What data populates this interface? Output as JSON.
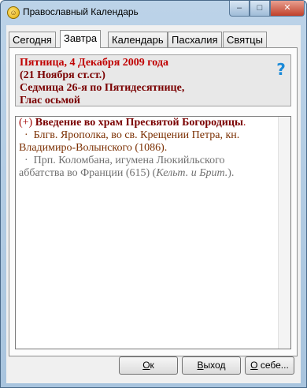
{
  "window": {
    "title": "Православный Календарь"
  },
  "titlebar": {
    "minimize": "–",
    "maximize": "□",
    "close": "✕"
  },
  "tabs": [
    {
      "label": "Сегодня"
    },
    {
      "label": "Завтра"
    },
    {
      "label": "Календарь"
    },
    {
      "label": "Пасхалия"
    },
    {
      "label": "Святцы"
    }
  ],
  "header": {
    "date": "Пятница, 4 Декабря 2009 года",
    "old_style": "(21 Ноября ст.ст.)",
    "week": "Седмица 26-я по Пятидесятнице,",
    "tone": "Глас осьмой",
    "help_icon": "help-icon"
  },
  "content": {
    "feast_mark": "(+)",
    "feast_title": "Введение во храм Пресвятой Богородицы",
    "feast_end": ".",
    "saint1_bullet": "·",
    "saint1": "Блгв. Ярополка, во св. Крещении Петра, кн. Владимиро-Волынского (1086).",
    "saint2_bullet": "·",
    "saint2": "Прп. Коломбана, игумена Люкийльского аббатства во Франции (615) (",
    "saint2_note": "Кельт. и Брит.",
    "saint2_end": ")."
  },
  "buttons": {
    "ok_prefix": "",
    "ok_access": "О",
    "ok_rest": "к",
    "exit_access": "В",
    "exit_rest": "ыход",
    "about_access": "О",
    "about_rest": " себе..."
  }
}
